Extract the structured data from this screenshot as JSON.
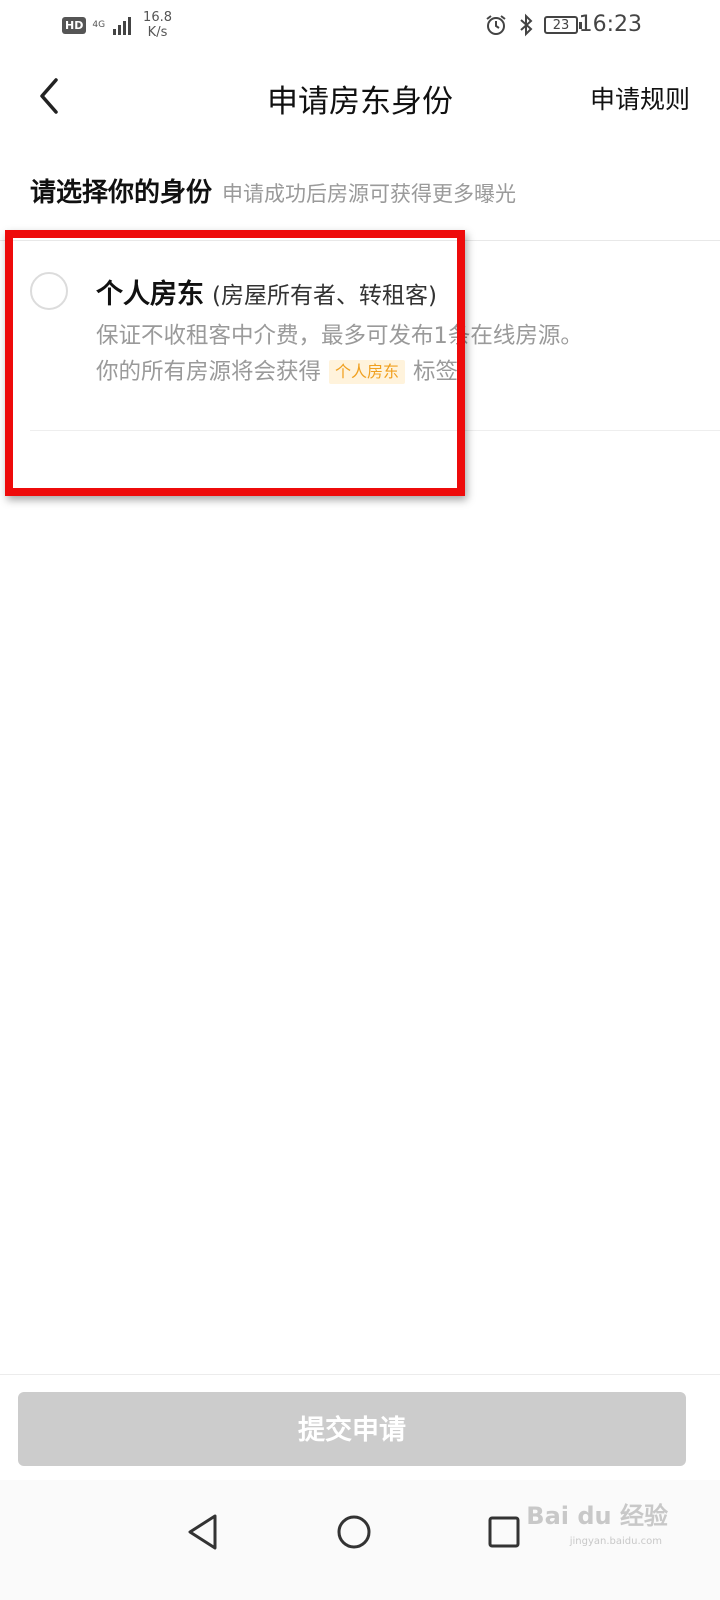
{
  "status_bar": {
    "hd": "HD",
    "network": "4G",
    "speed_value": "16.8",
    "speed_unit": "K/s",
    "battery": "23",
    "time": "16:23"
  },
  "header": {
    "title": "申请房东身份",
    "rules_link": "申请规则"
  },
  "section": {
    "title": "请选择你的身份",
    "hint": "申请成功后房源可获得更多曝光"
  },
  "option": {
    "title": "个人房东",
    "subtitle": "(房屋所有者、转租客)",
    "desc_line1": "保证不收租客中介费，最多可发布1条在线房源。",
    "desc_line2_prefix": "你的所有房源将会获得",
    "tag": "个人房东",
    "desc_line2_suffix": "标签",
    "selected": false
  },
  "submit_button": "提交申请",
  "watermark": {
    "text": "Bai du 经验",
    "sub": "jingyan.baidu.com"
  },
  "colors": {
    "highlight": "#ee0b0b",
    "tag_bg": "#fff3dc",
    "tag_text": "#f0a020",
    "button_disabled": "#cccccc"
  }
}
